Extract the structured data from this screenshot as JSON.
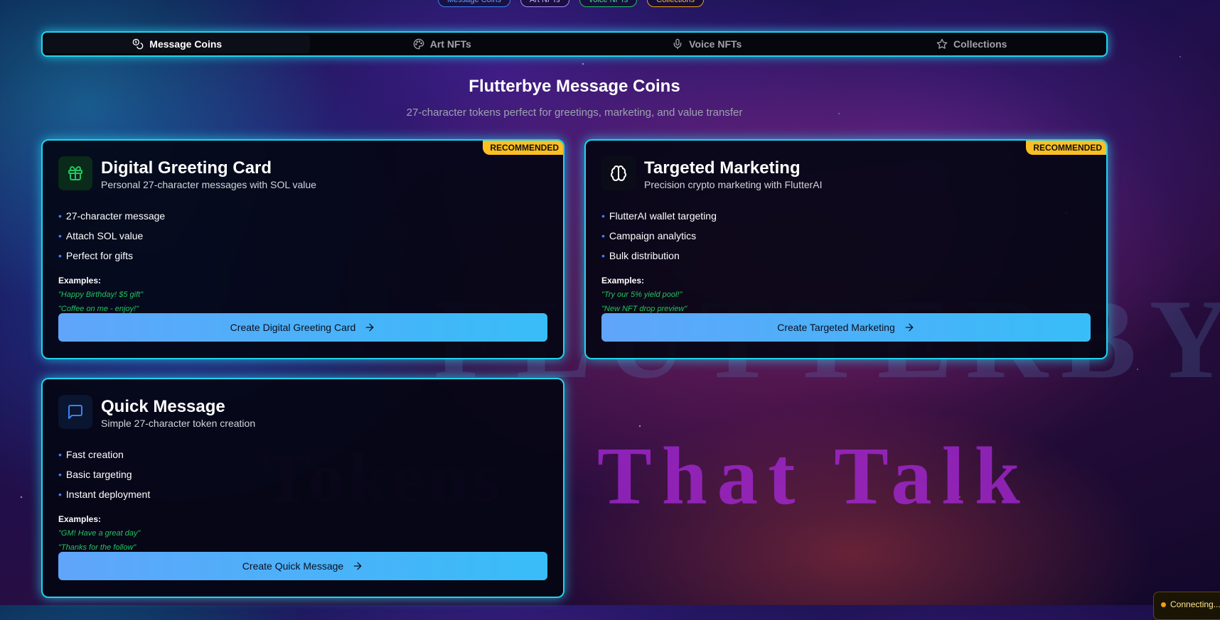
{
  "top_pills": [
    "Message Coins",
    "Art NFTs",
    "Voice NFTs",
    "Collections"
  ],
  "tabs": [
    {
      "label": "Message Coins",
      "icon": "coins-icon",
      "active": true
    },
    {
      "label": "Art NFTs",
      "icon": "palette-icon",
      "active": false
    },
    {
      "label": "Voice NFTs",
      "icon": "microphone-icon",
      "active": false
    },
    {
      "label": "Collections",
      "icon": "star-icon",
      "active": false
    }
  ],
  "header": {
    "title": "Flutterbye Message Coins",
    "subtitle": "27-character tokens perfect for greetings, marketing, and value transfer"
  },
  "watermark": {
    "brand": "FLUTTERBYE",
    "tagline_part1": "Tokens",
    "tagline_part2": "That Talk"
  },
  "cards": [
    {
      "badge": "RECOMMENDED",
      "icon": "gift-icon",
      "icon_color": "#22c55e",
      "title": "Digital Greeting Card",
      "description": "Personal 27-character messages with SOL value",
      "features": [
        "27-character message",
        "Attach SOL value",
        "Perfect for gifts"
      ],
      "examples_label": "Examples:",
      "examples": [
        "\"Happy Birthday! $5 gift\"",
        "\"Coffee on me - enjoy!\""
      ],
      "cta": "Create Digital Greeting Card"
    },
    {
      "badge": "RECOMMENDED",
      "icon": "brain-icon",
      "icon_color": "#ffffff",
      "title": "Targeted Marketing",
      "description": "Precision crypto marketing with FlutterAI",
      "features": [
        "FlutterAI wallet targeting",
        "Campaign analytics",
        "Bulk distribution"
      ],
      "examples_label": "Examples:",
      "examples": [
        "\"Try our 5% yield pool!\"",
        "\"New NFT drop preview\""
      ],
      "cta": "Create Targeted Marketing"
    },
    {
      "badge": "",
      "icon": "message-square-icon",
      "icon_color": "#3b82f6",
      "title": "Quick Message",
      "description": "Simple 27-character token creation",
      "features": [
        "Fast creation",
        "Basic targeting",
        "Instant deployment"
      ],
      "examples_label": "Examples:",
      "examples": [
        "\"GM! Have a great day\"",
        "\"Thanks for the follow\""
      ],
      "cta": "Create Quick Message"
    }
  ],
  "connection_status": "Connecting..."
}
